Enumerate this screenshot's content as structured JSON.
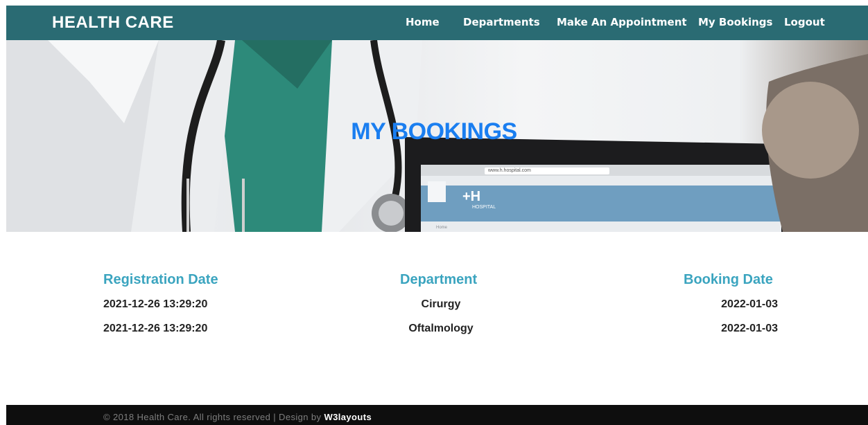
{
  "brand": "HEALTH CARE",
  "nav": {
    "home": "Home",
    "departments": "Departments",
    "appointment": "Make An Appointment",
    "bookings": "My Bookings",
    "logout": "Logout"
  },
  "hero": {
    "title": "MY BOOKINGS",
    "laptop_url": "www.h.hospital.com",
    "laptop_logo": "+H",
    "laptop_logo_sub": "HOSPITAL",
    "laptop_menu": "Home"
  },
  "table": {
    "headers": {
      "registration": "Registration Date",
      "department": "Department",
      "booking": "Booking Date"
    },
    "rows": [
      {
        "registration": "2021-12-26 13:29:20",
        "department": "Cirurgy",
        "booking": "2022-01-03"
      },
      {
        "registration": "2021-12-26 13:29:20",
        "department": "Oftalmology",
        "booking": "2022-01-03"
      }
    ]
  },
  "footer": {
    "text": "© 2018 Health Care. All rights reserved | Design by ",
    "link": "W3layouts"
  },
  "colors": {
    "navbar": "#2a6b73",
    "hero_title": "#1a7ef0",
    "column_header": "#3aa4bf",
    "footer": "#0e0e0e"
  }
}
